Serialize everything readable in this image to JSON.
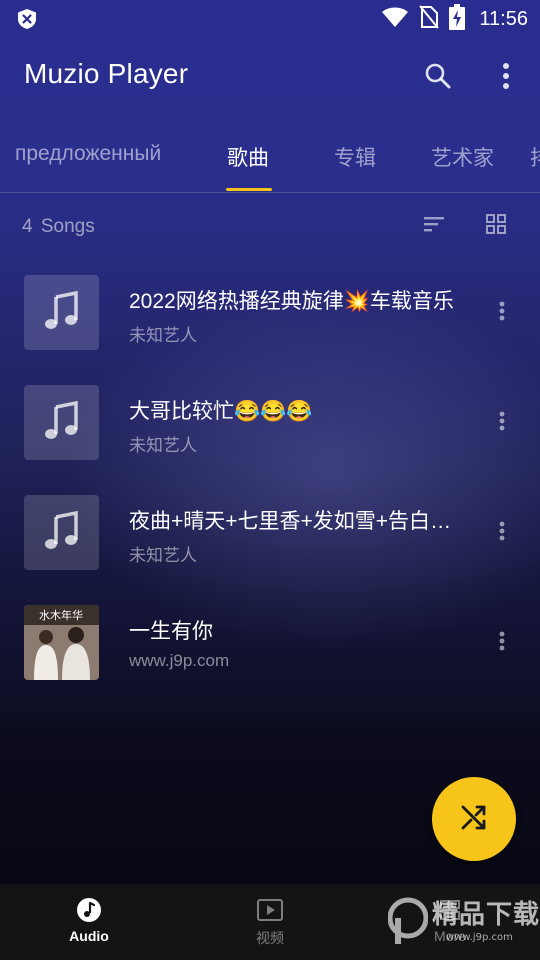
{
  "status_bar": {
    "time": "11:56",
    "icons": [
      "shield-x-icon",
      "wifi-icon",
      "no-sim-icon",
      "battery-charging-icon"
    ]
  },
  "app_bar": {
    "title": "Muzio Player",
    "icons": [
      "search-icon",
      "more-vert-icon"
    ]
  },
  "tabs": [
    {
      "label": "предложенный",
      "active": false
    },
    {
      "label": "歌曲",
      "active": true
    },
    {
      "label": "专辑",
      "active": false
    },
    {
      "label": "艺术家",
      "active": false
    },
    {
      "label": "排",
      "active": false
    }
  ],
  "songs_header": {
    "count": "4  Songs",
    "icons": [
      "sort-icon",
      "grid-view-icon"
    ]
  },
  "songs": [
    {
      "title": "2022网络热播经典旋律💥车载音乐",
      "artist": "未知艺人",
      "art": "music-note-icon"
    },
    {
      "title": "大哥比较忙😂😂😂",
      "artist": "未知艺人",
      "art": "music-note-icon"
    },
    {
      "title": "夜曲+晴天+七里香+发如雪+告白气球",
      "artist": "未知艺人",
      "art": "music-note-icon"
    },
    {
      "title": "一生有你",
      "artist": "www.j9p.com",
      "art": "album-cover-photo",
      "cover_text": "水木年华"
    }
  ],
  "fab": {
    "icon": "shuffle-icon",
    "color": "#f7c51a"
  },
  "bottom_nav": [
    {
      "label": "Audio",
      "icon": "music-note-circle-icon",
      "active": true
    },
    {
      "label": "视频",
      "icon": "video-play-icon",
      "active": false
    },
    {
      "label": "More",
      "icon": "grid-icon",
      "active": false
    }
  ],
  "watermark": {
    "text": "精品下载",
    "sub": "www.j9p.com"
  },
  "colors": {
    "accent": "#f5c21a",
    "background_top": "#2a2d8f",
    "background_bottom": "#060610",
    "nav_background": "#141414"
  }
}
